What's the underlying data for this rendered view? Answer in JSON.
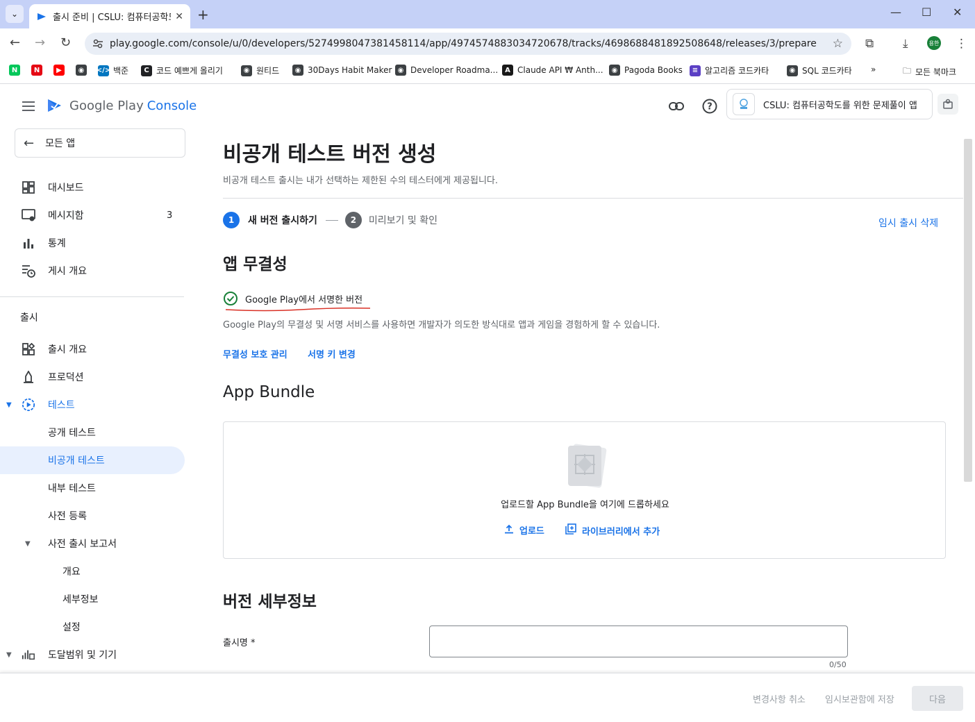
{
  "browser": {
    "tab_title": "출시 준비 | CSLU: 컴퓨터공학도",
    "url": "play.google.com/console/u/0/developers/5274998047381458114/app/4974574883034720678/tracks/4698688481892508648/releases/3/prepare",
    "profile_initials": "용한",
    "bookmarks": [
      {
        "label": "",
        "icon": "naver-icon",
        "color": "#03c75a",
        "text": "N"
      },
      {
        "label": "",
        "icon": "netflix-icon",
        "color": "#e50914",
        "text": "N"
      },
      {
        "label": "",
        "icon": "youtube-icon",
        "color": "#ff0000",
        "text": "▶"
      },
      {
        "label": "",
        "icon": "globe-icon",
        "color": "#3c4043",
        "text": "◉"
      },
      {
        "label": "백준",
        "icon": "baekjoon-icon",
        "color": "#0076c0",
        "text": "</>"
      },
      {
        "label": "코드 예쁘게 올리기",
        "icon": "code-icon",
        "color": "#202124",
        "text": "C"
      },
      {
        "label": "원티드",
        "icon": "globe-icon",
        "color": "#3c4043",
        "text": "◉"
      },
      {
        "label": "30Days Habit Maker",
        "icon": "globe-icon",
        "color": "#3c4043",
        "text": "◉"
      },
      {
        "label": "Developer Roadma...",
        "icon": "globe-icon",
        "color": "#3c4043",
        "text": "◉"
      },
      {
        "label": "Claude API ₩ Anth...",
        "icon": "anthropic-icon",
        "color": "#191919",
        "text": "A"
      },
      {
        "label": "Pagoda Books",
        "icon": "globe-icon",
        "color": "#3c4043",
        "text": "◉"
      },
      {
        "label": "알고리즘 코드카타",
        "icon": "notion-icon",
        "color": "#5b3fc4",
        "text": "≡"
      },
      {
        "label": "SQL 코드카타",
        "icon": "globe-icon",
        "color": "#3c4043",
        "text": "◉"
      }
    ],
    "all_bookmarks": "모든 북마크",
    "more_bookmarks": "»"
  },
  "header": {
    "logo_google_play": "Google Play",
    "logo_console": "Console",
    "app_name": "CSLU: 컴퓨터공학도를 위한 문제풀이 앱"
  },
  "sidebar": {
    "all_apps": "모든 앱",
    "top_items": [
      {
        "label": "대시보드",
        "icon": "dashboard-icon"
      },
      {
        "label": "메시지함",
        "icon": "inbox-icon",
        "badge": "3"
      },
      {
        "label": "통계",
        "icon": "bar-chart-icon"
      },
      {
        "label": "게시 개요",
        "icon": "publishing-overview-icon"
      }
    ],
    "section_release": "출시",
    "release_items": [
      {
        "label": "출시 개요",
        "icon": "release-overview-icon"
      },
      {
        "label": "프로덕션",
        "icon": "production-icon"
      },
      {
        "label": "테스트",
        "icon": "testing-icon"
      }
    ],
    "testing_children": [
      "공개 테스트",
      "비공개 테스트",
      "내부 테스트",
      "사전 등록"
    ],
    "prelaunch": "사전 출시 보고서",
    "prelaunch_children": [
      "개요",
      "세부정보",
      "설정"
    ],
    "reach": "도달범위 및 기기"
  },
  "main": {
    "title": "비공개 테스트 버전 생성",
    "subtitle": "비공개 테스트 출시는 내가 선택하는 제한된 수의 테스터에게 제공됩니다.",
    "step1_num": "1",
    "step1_label": "새 버전 출시하기",
    "step2_num": "2",
    "step2_label": "미리보기 및 확인",
    "discard_label": "임시 출시 삭제",
    "integrity_heading": "앱 무결성",
    "signed_status": "Google Play에서 서명한 버전",
    "integrity_desc": "Google Play의 무결성 및 서명 서비스를 사용하면 개발자가 의도한 방식대로 앱과 게임을 경험하게 할 수 있습니다.",
    "manage_integrity_link": "무결성 보호 관리",
    "change_key_link": "서명 키 변경",
    "bundle_heading": "App Bundle",
    "drop_text": "업로드할 App Bundle을 여기에 드롭하세요",
    "upload_label": "업로드",
    "library_label": "라이브러리에서 추가",
    "details_heading": "버전 세부정보",
    "release_name_label": "출시명  *",
    "release_name_value": "",
    "release_name_counter": "0/50"
  },
  "footer": {
    "discard_changes": "변경사항 취소",
    "save_draft": "임시보관함에 저장",
    "next": "다음"
  },
  "colors": {
    "accent": "#1a73e8",
    "success": "#188038",
    "annotation_red": "#d93025",
    "tab_strip": "#c5d1f7"
  }
}
